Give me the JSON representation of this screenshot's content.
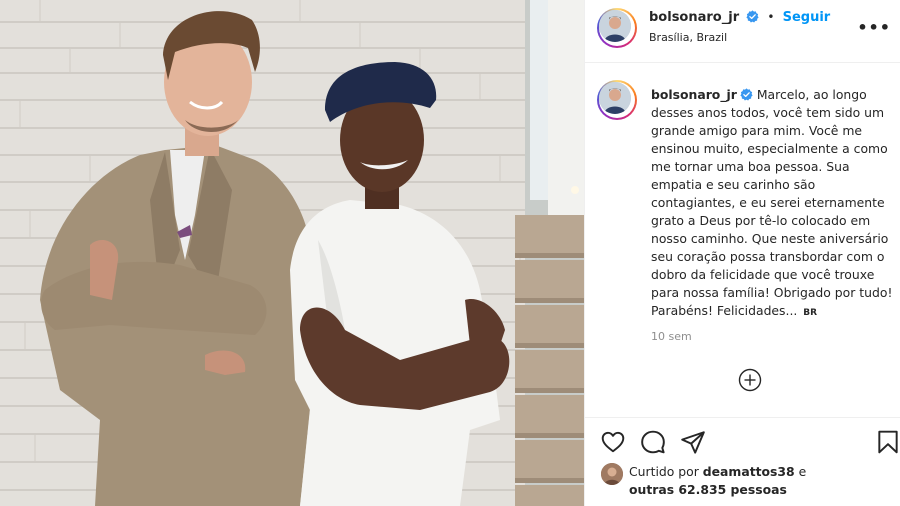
{
  "post": {
    "photo_alt": "Duas pessoas de braços cruzados, costas com costas",
    "brand_colors": {
      "follow": "#0095f6",
      "verified": "#3897f0",
      "muted": "#8e8e8e"
    }
  },
  "header": {
    "username": "bolsonaro_jr",
    "separator": "•",
    "follow_label": "Seguir",
    "location": "Brasília, Brazil",
    "more_label": "•••",
    "verified_icon": "verified-badge-icon",
    "more_icon": "more-options-icon"
  },
  "caption": {
    "username": "bolsonaro_jr",
    "text": "Marcelo, ao longo desses anos todos, você tem sido um grande amigo para mim. Você me ensinou muito, especialmente a como me tornar uma boa pessoa. Sua empatia e seu carinho são contagiantes, e eu serei eternamente grato a Deus por tê-lo colocado em nosso caminho. Que neste aniversário seu coração possa transbordar com o dobro da felicidade que você trouxe para nossa família! Obrigado por tudo! Parabéns! Felicidades...",
    "translate_label": "BR",
    "time": "10 sem"
  },
  "load_more": {
    "icon": "plus-circle-icon"
  },
  "actions": {
    "icons": [
      "heart-icon",
      "comment-icon",
      "share-icon",
      "bookmark-icon"
    ],
    "likes_prefix": "Curtido por",
    "liked_by": "deamattos38",
    "likes_connector": "e",
    "likes_others": "outras 62.835 pessoas"
  }
}
